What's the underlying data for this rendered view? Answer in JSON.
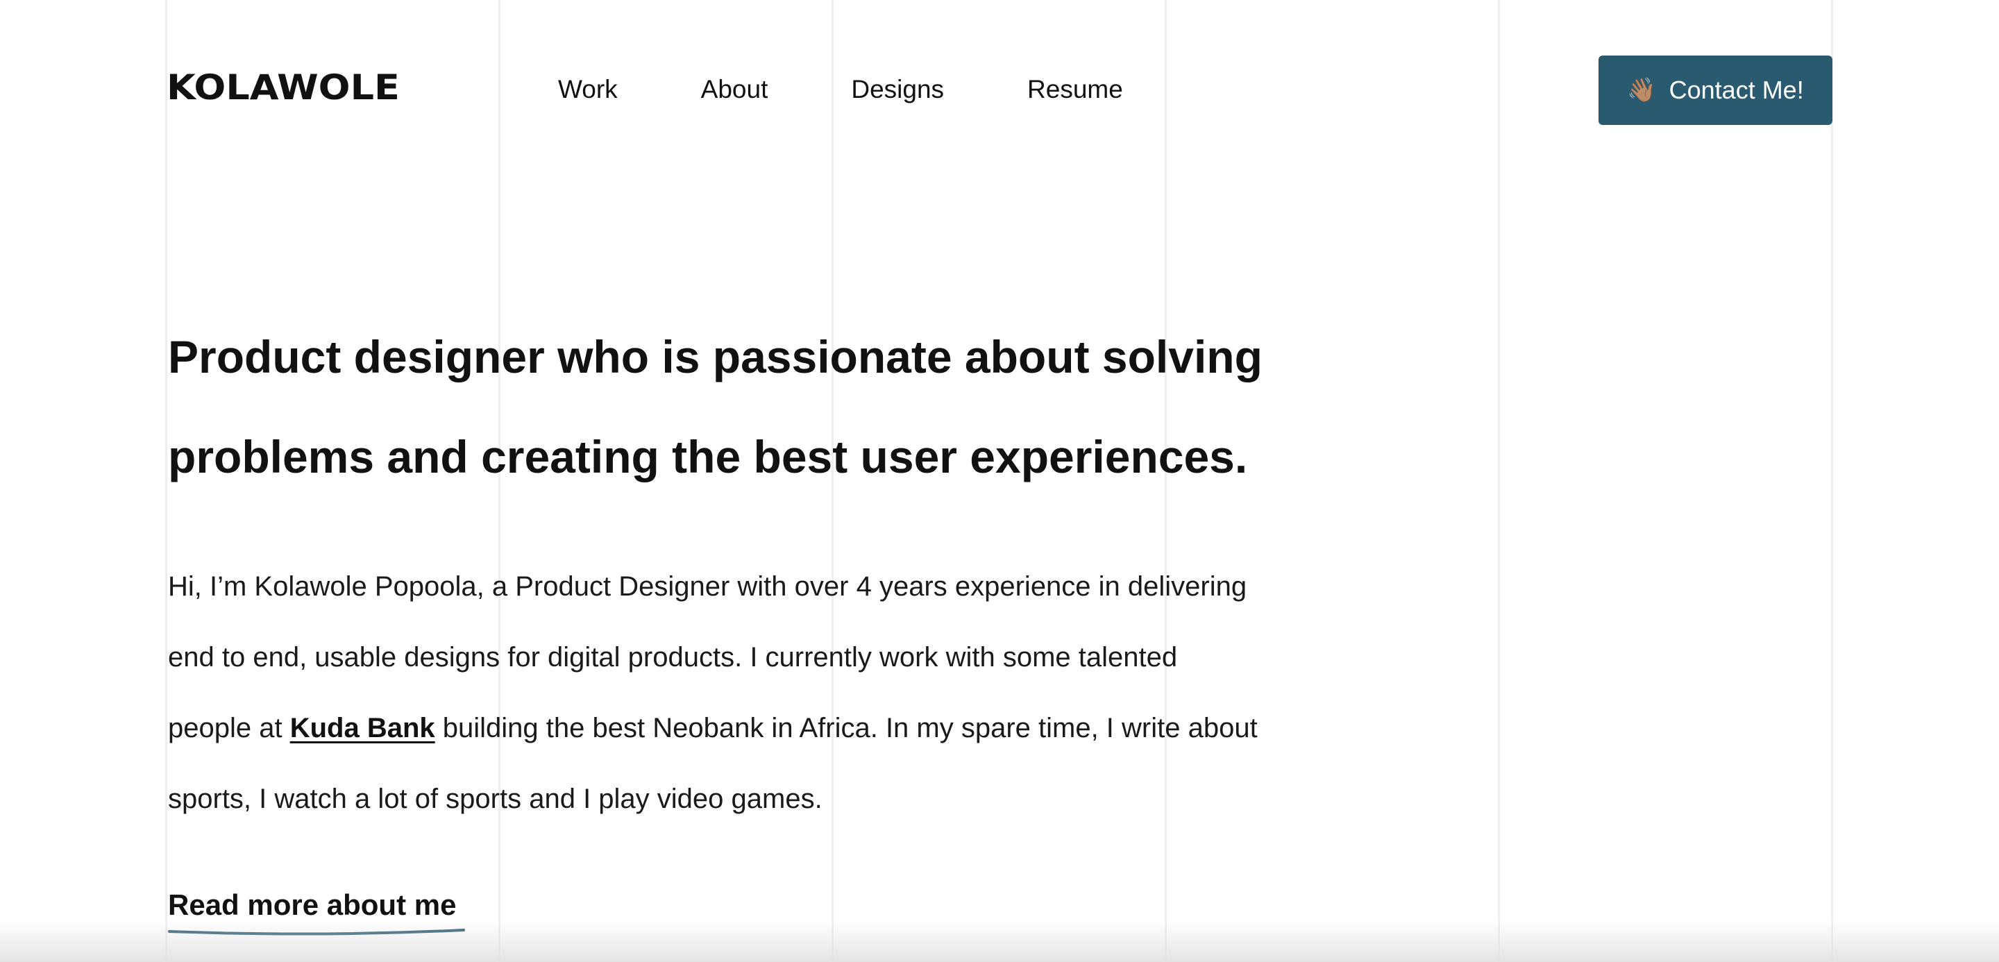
{
  "header": {
    "logo": "KOLAWOLE",
    "nav": [
      "Work",
      "About",
      "Designs",
      "Resume"
    ],
    "contact_button": {
      "icon": "👋🏽",
      "label": "Contact Me!"
    }
  },
  "hero": {
    "title_lines": [
      "Product designer who is passionate about solving",
      "problems and creating the best user experiences."
    ],
    "bio": {
      "line1": "Hi, I’m Kolawole Popoola, a Product Designer with over 4 years experience in delivering",
      "line2": "end to end, usable designs for digital products. I currently work with some talented",
      "line3_before": "people at ",
      "line3_link": "Kuda Bank",
      "line3_after": " building the best Neobank in Africa. In my spare time, I write about",
      "line4": "sports, I watch a lot of sports and I play video games."
    },
    "read_more": "Read more about me"
  },
  "colors": {
    "accent": "#2a5a6f",
    "text": "#111111",
    "grid": "#efefef"
  }
}
